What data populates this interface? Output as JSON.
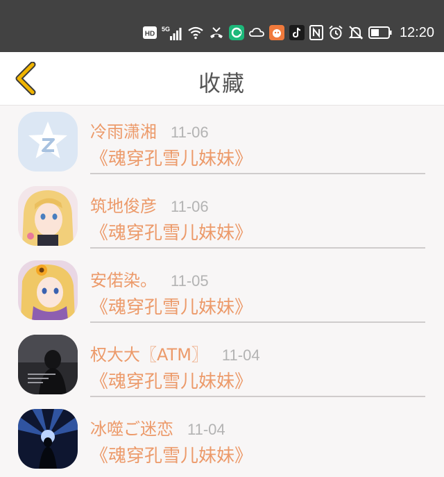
{
  "status_bar": {
    "time": "12:20",
    "hd_badge": "HD",
    "network": "5G",
    "icons": [
      "hd-badge-icon",
      "signal-icon",
      "wifi-icon",
      "missed-call-icon",
      "app-green-icon",
      "cloud-icon",
      "app-orange-icon",
      "tiktok-icon",
      "nfc-icon",
      "alarm-icon",
      "mute-icon",
      "battery-icon"
    ]
  },
  "header": {
    "title": "收藏",
    "back_icon": "chevron-left-icon",
    "accent_color": "#f0b400"
  },
  "favorites": [
    {
      "username": "冷雨潇湘",
      "date": "11-06",
      "book": "《魂穿孔雪儿妹妹》",
      "avatar": "qq-star-icon"
    },
    {
      "username": "筑地俊彦",
      "date": "11-06",
      "book": "《魂穿孔雪儿妹妹》",
      "avatar": "anime-blonde-girl"
    },
    {
      "username": "安偌染。",
      "date": "11-05",
      "book": "《魂穿孔雪儿妹妹》",
      "avatar": "anime-girl-sunflower"
    },
    {
      "username": "权大大〖ATM〗",
      "date": "11-04",
      "book": "《魂穿孔雪儿妹妹》",
      "avatar": "dark-photo"
    },
    {
      "username": "冰噬ご迷恋",
      "date": "11-04",
      "book": "《魂穿孔雪儿妹妹》",
      "avatar": "blue-light-figure"
    }
  ],
  "colors": {
    "name_text": "#ec9a6a",
    "date_text": "#b3b3b3",
    "status_bar_bg": "#424242"
  }
}
